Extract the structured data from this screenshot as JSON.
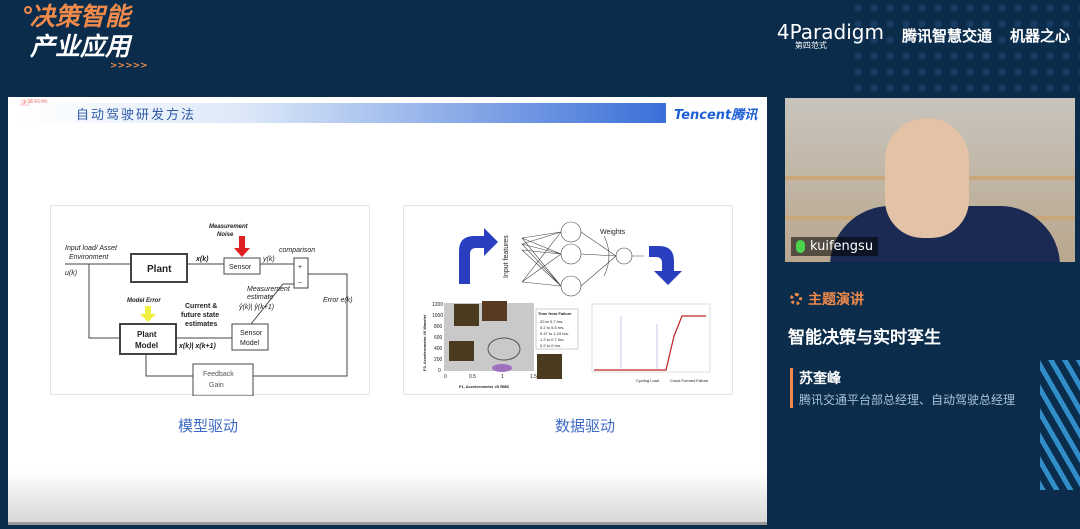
{
  "event": {
    "line1": "决策智能",
    "line2": "产业应用",
    "chevrons": ">>>>>"
  },
  "sponsors": {
    "paradigm": "4Paradigm",
    "paradigm_cn": "第四范式",
    "tencent_traffic": "腾讯智慧交通",
    "jiqizhixin": "机器之心"
  },
  "slide": {
    "mini_logo": "决策智能",
    "title": "自动驾驶研发方法",
    "brand": "Tencent腾讯",
    "fig1": {
      "input": "Input load/ Asset",
      "env": "Environment",
      "uk": "u(k)",
      "noise1": "Measurement",
      "noise2": "Noise",
      "plant": "Plant",
      "xk": "x(k)",
      "sensor": "Sensor",
      "yk": "y(k)",
      "comparison": "comparison",
      "plus": "+",
      "minus": "−",
      "me1": "Measurement",
      "me2": "estimate",
      "yhat": "ŷ(k)| ŷ(k+1)",
      "model_error": "Model Error",
      "cur1": "Current &",
      "cur2": "future state",
      "cur3": "estimates",
      "xx": "x(k)| x(k+1)",
      "pm1": "Plant",
      "pm2": "Model",
      "sm1": "Sensor",
      "sm2": "Model",
      "error": "Error e(k)",
      "fb1": "Feedback",
      "fb2": "Gain"
    },
    "fig2": {
      "input_features": "Input features",
      "weights": "Weights",
      "xlabel": "F1, Accelerometer #0 RMS",
      "ylabel": "F2, Accelerometer #0 Wavelet",
      "legend_title": "Time from Failure",
      "legend": [
        "20 to 0.7 hrs.",
        "0.2 to 5.5 hrs.",
        "0.47 to 1.24 hrs.",
        "1.2 to 0.7 hrs.",
        "0.2 to 0 hrs."
      ],
      "yticks": [
        "1200",
        "1000",
        "800",
        "600",
        "400",
        "200",
        "0"
      ],
      "xticks": [
        "0",
        "0.5",
        "1",
        "1.5"
      ],
      "cycling": "Cycling Load",
      "crack": "Crack Formed",
      "failure": "Failure"
    },
    "captions": [
      "模型驱动",
      "数据驱动"
    ]
  },
  "webcam": {
    "name": "kuifengsu"
  },
  "talk": {
    "tag": "主题演讲",
    "title": "智能决策与实时孪生",
    "speaker": "苏奎峰",
    "role": "腾讯交通平台部总经理、自动驾驶总经理"
  }
}
